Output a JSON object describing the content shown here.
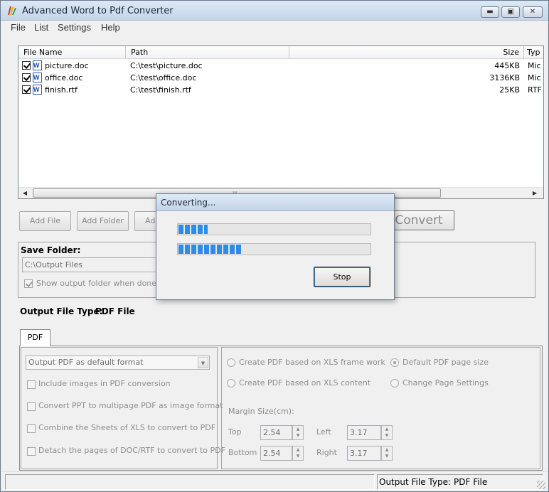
{
  "window": {
    "title": "Advanced Word to Pdf Converter",
    "btn_min": "▬",
    "btn_max": "▣",
    "btn_close": "✕"
  },
  "menu": [
    "File",
    "List",
    "Settings",
    "Help"
  ],
  "filelist": {
    "headers": {
      "name": "File Name",
      "path": "Path",
      "size": "Size",
      "type": "Typ"
    },
    "rows": [
      {
        "name": "picture.doc",
        "path": "C:\\test\\picture.doc",
        "size": "445KB",
        "type": "Mic",
        "checked": true
      },
      {
        "name": "office.doc",
        "path": "C:\\test\\office.doc",
        "size": "3136KB",
        "type": "Mic",
        "checked": true
      },
      {
        "name": "finish.rtf",
        "path": "C:\\test\\finish.rtf",
        "size": "25KB",
        "type": "RTF",
        "checked": true
      }
    ],
    "scroll_left": "◀",
    "scroll_right": "▶",
    "scroll_grip": "III"
  },
  "buttons": {
    "add_file": "Add File",
    "add_folder": "Add Folder",
    "add_more": "Add",
    "convert": "Convert"
  },
  "save_folder": {
    "label": "Save Folder:",
    "value": "C:\\Output Files",
    "show_output": "Show output folder when done",
    "show_output_checked": true
  },
  "output_type": {
    "label": "Output File Type:",
    "value": "PDF File"
  },
  "tabs": [
    "PDF"
  ],
  "pdf_options": {
    "format_select": "Output PDF as default format",
    "checkboxes": [
      "Include images in PDF conversion",
      "Convert PPT to multipage PDF as image format",
      "Combine the Sheets of XLS to convert to PDF",
      "Detach the pages of DOC/RTF to convert to PDF"
    ],
    "radios_left": [
      "Create PDF based on XLS frame work",
      "Create PDF based on XLS content"
    ],
    "radios_right": [
      "Default PDF page size",
      "Change Page Settings"
    ],
    "margin_label": "Margin Size(cm):",
    "margins": {
      "top_label": "Top",
      "top": "2.54",
      "left_label": "Left",
      "left": "3.17",
      "bottom_label": "Bottom",
      "bottom": "2.54",
      "right_label": "Right",
      "right": "3.17"
    }
  },
  "statusbar": {
    "label": "Output File Type:",
    "value": "PDF File"
  },
  "dialog": {
    "title": "Converting...",
    "progress_1": 0.15,
    "progress_2": 0.33,
    "stop": "Stop"
  },
  "colors": {
    "progress": "#2d8de6",
    "titlebar": "#c5d6ea"
  }
}
